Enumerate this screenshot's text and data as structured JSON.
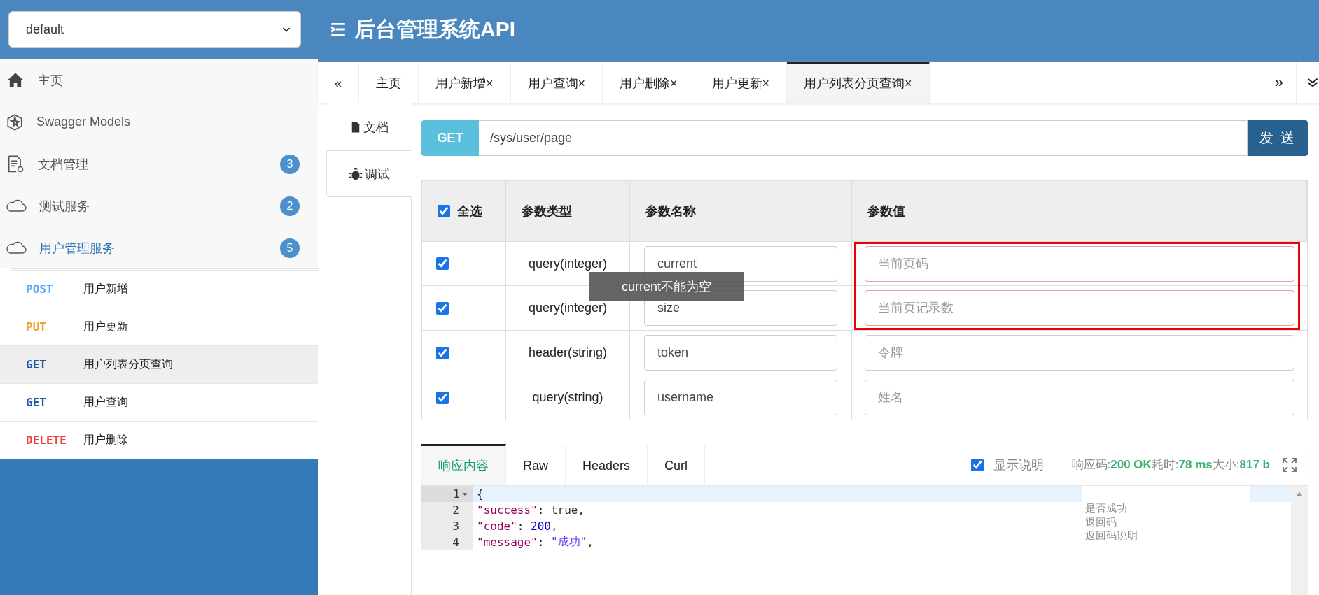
{
  "header": {
    "group_select": {
      "value": "default"
    },
    "title": "后台管理系统API"
  },
  "sidebar": {
    "items": [
      {
        "kind": "home",
        "label": "主页",
        "expanded": false
      },
      {
        "kind": "models",
        "label": "Swagger Models",
        "expanded": false
      },
      {
        "kind": "docs",
        "label": "文档管理",
        "badge": "3",
        "expanded": false
      },
      {
        "kind": "cloud",
        "label": "测试服务",
        "badge": "2",
        "expanded": false
      },
      {
        "kind": "cloud",
        "label": "用户管理服务",
        "badge": "5",
        "expanded": true,
        "children": [
          {
            "method": "POST",
            "color": "#5aa7ff",
            "label": "用户新增",
            "selected": false
          },
          {
            "method": "PUT",
            "color": "#f0a030",
            "label": "用户更新",
            "selected": false
          },
          {
            "method": "GET",
            "color": "#1d5aa0",
            "label": "用户列表分页查询",
            "selected": true
          },
          {
            "method": "GET",
            "color": "#1d5aa0",
            "label": "用户查询",
            "selected": false
          },
          {
            "method": "DELETE",
            "color": "#f03c3c",
            "label": "用户删除",
            "selected": false
          }
        ]
      }
    ]
  },
  "tab_bar": {
    "prev": "«",
    "next": "»",
    "tabs": [
      {
        "label": "主页",
        "selected": false
      },
      {
        "label": "用户新增×",
        "selected": false
      },
      {
        "label": "用户查询×",
        "selected": false
      },
      {
        "label": "用户删除×",
        "selected": false
      },
      {
        "label": "用户更新×",
        "selected": false
      },
      {
        "label": "用户列表分页查询×",
        "selected": true
      }
    ]
  },
  "side_tabs": [
    {
      "kind": "doc",
      "label": "文档",
      "selected": false
    },
    {
      "kind": "debug",
      "label": "调试",
      "selected": true
    }
  ],
  "request": {
    "method": "GET",
    "url": "/sys/user/page",
    "send": "发 送"
  },
  "params": {
    "select_all": {
      "label": "全选",
      "checked": true
    },
    "columns": [
      "参数类型",
      "参数名称",
      "参数值"
    ],
    "rows": [
      {
        "checked": true,
        "type": "query(integer)",
        "name": "current",
        "placeholder": "当前页码",
        "invalid": true,
        "highlighted": true
      },
      {
        "checked": true,
        "type": "query(integer)",
        "name": "size",
        "placeholder": "当前页记录数",
        "invalid": true,
        "highlighted": true
      },
      {
        "checked": true,
        "type": "header(string)",
        "name": "token",
        "placeholder": "令牌",
        "invalid": false,
        "highlighted": false
      },
      {
        "checked": true,
        "type": "query(string)",
        "name": "username",
        "placeholder": "姓名",
        "invalid": false,
        "highlighted": false
      }
    ],
    "toast": "current不能为空"
  },
  "response": {
    "tabs": [
      {
        "label": "响应内容",
        "selected": true
      },
      {
        "label": "Raw",
        "selected": false
      },
      {
        "label": "Headers",
        "selected": false
      },
      {
        "label": "Curl",
        "selected": false
      }
    ],
    "show_notes": {
      "label": "显示说明",
      "checked": true
    },
    "stats": [
      {
        "label": "响应码:",
        "value": "200 OK"
      },
      {
        "label": "耗时:",
        "value": "78 ms"
      },
      {
        "label": "大小:",
        "value": "817 b"
      }
    ],
    "lines": [
      {
        "number": "1",
        "foldable": true,
        "current": true,
        "parts": [
          {
            "kind": "punct",
            "text": "{"
          }
        ]
      },
      {
        "number": "2",
        "foldable": false,
        "current": false,
        "parts": [
          {
            "kind": "key",
            "text": "\"success\""
          },
          {
            "kind": "punct",
            "text": ": "
          },
          {
            "kind": "bool",
            "text": "true"
          },
          {
            "kind": "punct",
            "text": ","
          }
        ],
        "note": "是否成功"
      },
      {
        "number": "3",
        "foldable": false,
        "current": false,
        "parts": [
          {
            "kind": "key",
            "text": "\"code\""
          },
          {
            "kind": "punct",
            "text": ": "
          },
          {
            "kind": "number",
            "text": "200"
          },
          {
            "kind": "punct",
            "text": ","
          }
        ],
        "note": "返回码"
      },
      {
        "number": "4",
        "foldable": false,
        "current": false,
        "parts": [
          {
            "kind": "key",
            "text": "\"message\""
          },
          {
            "kind": "punct",
            "text": ": "
          },
          {
            "kind": "string",
            "text": "\"成功\""
          },
          {
            "kind": "punct",
            "text": ","
          }
        ],
        "note": "返回码说明"
      }
    ]
  }
}
